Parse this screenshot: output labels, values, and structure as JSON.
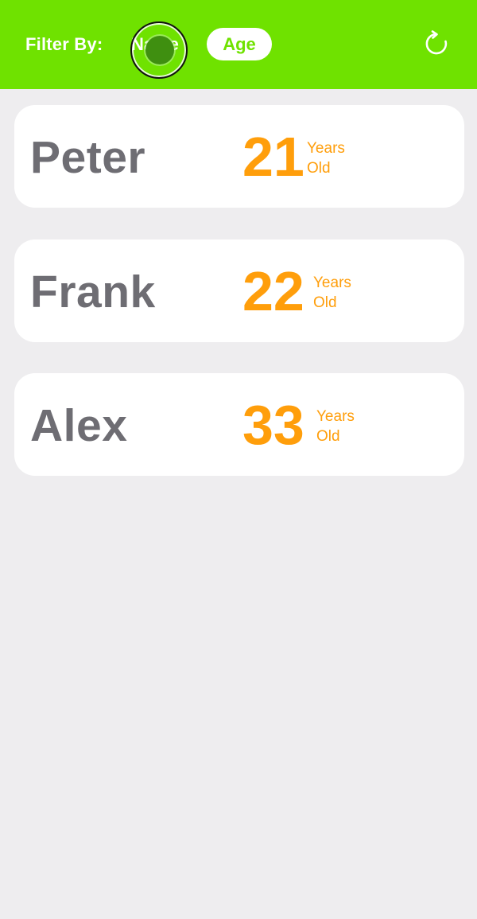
{
  "filter_bar": {
    "label": "Filter By:",
    "options": [
      {
        "label": "Name",
        "selected": false
      },
      {
        "label": "Age",
        "selected": true
      }
    ],
    "refresh_icon": "refresh-icon"
  },
  "people": [
    {
      "name": "Peter",
      "age": "21",
      "unit_line1": "Years",
      "unit_line2": "Old"
    },
    {
      "name": "Frank",
      "age": "22",
      "unit_line1": "Years",
      "unit_line2": "Old"
    },
    {
      "name": "Alex",
      "age": "33",
      "unit_line1": "Years",
      "unit_line2": "Old"
    }
  ],
  "colors": {
    "header_green": "#6fe200",
    "background": "#eeedef",
    "card": "#ffffff",
    "name_gray": "#6e6d73",
    "age_orange": "#ff9e0b"
  }
}
